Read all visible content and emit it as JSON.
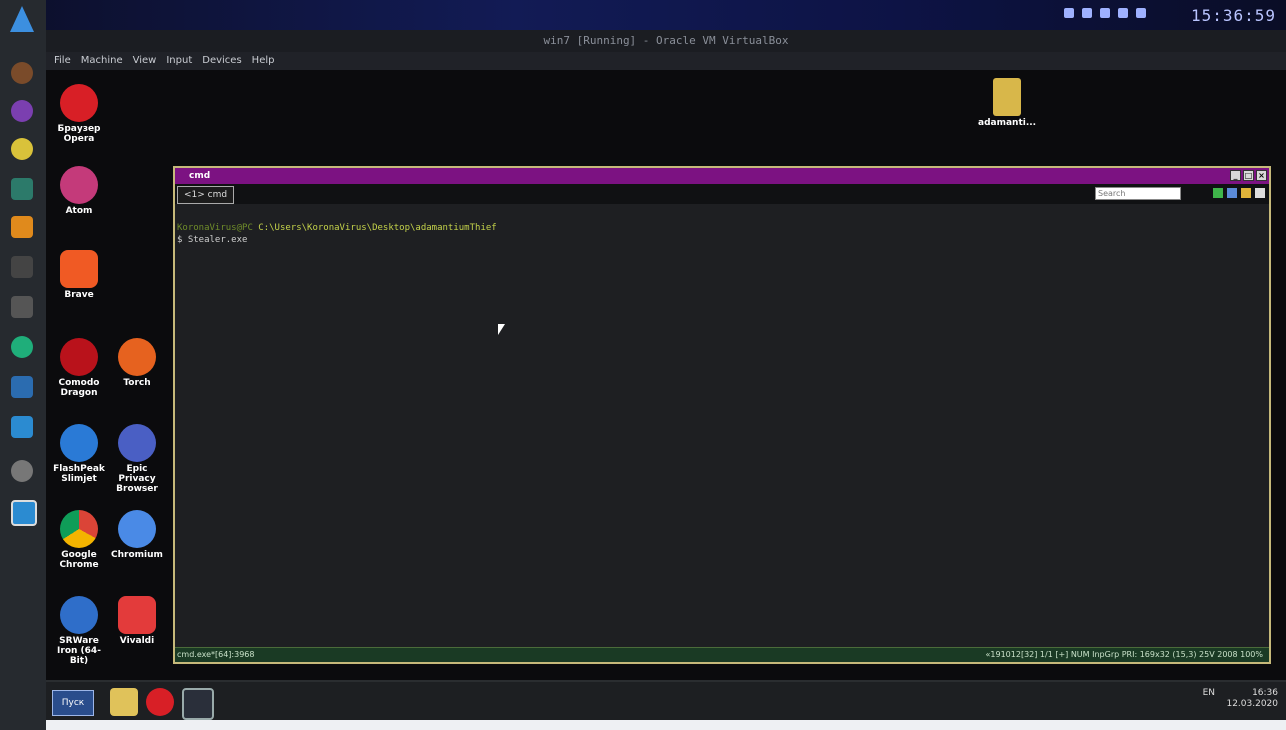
{
  "host": {
    "clock": "15:36:59"
  },
  "vm_window": {
    "title": "win7 [Running] - Oracle VM VirtualBox",
    "menu": [
      "File",
      "Machine",
      "View",
      "Input",
      "Devices",
      "Help"
    ]
  },
  "desktop_icons": [
    {
      "label": "Браузер Opera"
    },
    {
      "label": "Atom"
    },
    {
      "label": "Brave"
    },
    {
      "label": "Comodo Dragon"
    },
    {
      "label": "Torch"
    },
    {
      "label": "FlashPeak Slimjet"
    },
    {
      "label": "Epic Privacy Browser"
    },
    {
      "label": "Google Chrome"
    },
    {
      "label": "Chromium"
    },
    {
      "label": "SRWare Iron (64-Bit)"
    },
    {
      "label": "Vivaldi"
    },
    {
      "label": "adamanti..."
    }
  ],
  "cmd": {
    "title": "cmd",
    "tab": "<1> cmd",
    "search_placeholder": "Search",
    "prompt_user": "KoronaVirus@PC",
    "prompt_path": "C:\\Users\\KoronaVirus\\Desktop\\adamantiumThief",
    "command": "$ Stealer.exe",
    "status_left": "cmd.exe*[64]:3968",
    "status_right": "«191012[32]  1/1  [+] NUM  InpGrp  PRI:  169x32    (15,3) 25V    2008  100%"
  },
  "taskbar": {
    "start_label": "Пуск",
    "lang": "EN",
    "time": "16:36",
    "date": "12.03.2020"
  },
  "colors": {
    "cmd_title_bg": "#7c1282",
    "cmd_border": "#c6b97a",
    "prompt_user": "#6f8c2a",
    "prompt_path": "#c4d24a"
  }
}
